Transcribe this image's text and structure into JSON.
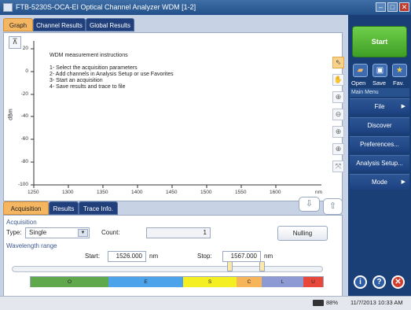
{
  "window": {
    "title": "FTB-5230S-OCA-EI Optical Channel Analyzer WDM [1-2]"
  },
  "top_tabs": [
    {
      "label": "Graph",
      "active": true
    },
    {
      "label": "Channel Results",
      "active": false
    },
    {
      "label": "Global Results",
      "active": false
    }
  ],
  "graph": {
    "y_axis_label": "dBm",
    "x_unit": "nm",
    "y_ticks": [
      "20",
      "0",
      "-20",
      "-40",
      "-60",
      "-80",
      "-100"
    ],
    "x_ticks": [
      "1250",
      "1300",
      "1350",
      "1400",
      "1450",
      "1500",
      "1550",
      "1600"
    ],
    "instructions_title": "WDM measurement instructions",
    "instructions": [
      "1- Select the acquisition parameters",
      "2- Add channels in Analysis Setup or use Favorites",
      "3- Start an acquisition",
      "4- Save results and trace to file"
    ]
  },
  "graph_tools": [
    "cursor-arrow-icon",
    "pan-hand-icon",
    "zoom-box-icon",
    "zoom-out-icon",
    "zoom-in-horizontal-icon",
    "zoom-in-vertical-icon",
    "zoom-full-icon"
  ],
  "bottom_tabs": [
    {
      "label": "Acquisition",
      "active": true
    },
    {
      "label": "Results",
      "active": false
    },
    {
      "label": "Trace Info.",
      "active": false
    }
  ],
  "acquisition": {
    "group_label": "Acquisition",
    "type_label": "Type:",
    "type_value": "Single",
    "count_label": "Count:",
    "count_value": "1",
    "nulling_label": "Nulling"
  },
  "wavelength": {
    "group_label": "Wavelength range",
    "start_label": "Start:",
    "start_value": "1526.000",
    "start_unit": "nm",
    "stop_label": "Stop:",
    "stop_value": "1567.000",
    "stop_unit": "nm",
    "bands": [
      {
        "label": "O",
        "color": "#5fa84c"
      },
      {
        "label": "E",
        "color": "#4da3ea"
      },
      {
        "label": "S",
        "color": "#f4ef22"
      },
      {
        "label": "C",
        "color": "#f7b55a"
      },
      {
        "label": "L",
        "color": "#8e9ad4"
      },
      {
        "label": "U",
        "color": "#e8483a"
      }
    ]
  },
  "side_panel": {
    "start_label": "Start",
    "open_label": "Open",
    "save_label": "Save",
    "fav_label": "Fav.",
    "main_menu_label": "Main Menu",
    "menu": [
      {
        "label": "File",
        "arrow": "▶"
      },
      {
        "label": "Discover",
        "arrow": ""
      },
      {
        "label": "Preferences...",
        "arrow": ""
      },
      {
        "label": "Analysis Setup...",
        "arrow": ""
      },
      {
        "label": "Mode",
        "arrow": "▶"
      }
    ]
  },
  "status": {
    "battery": "88%",
    "datetime": "11/7/2013 10:33 AM"
  },
  "colors": {
    "accent": "#f5b661",
    "navy": "#1a3f77",
    "start_green": "#4caf2f"
  }
}
